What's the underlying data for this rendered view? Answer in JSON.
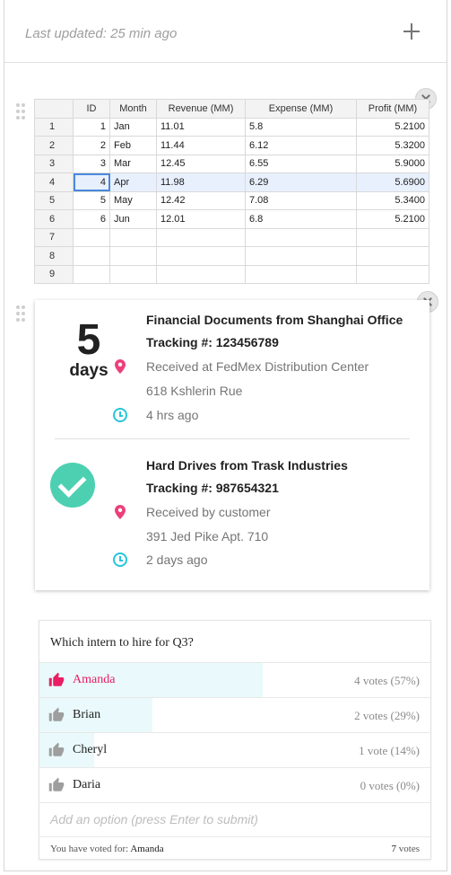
{
  "header": {
    "last_updated": "Last updated: 25 min ago",
    "add_icon": "plus-icon"
  },
  "spreadsheet": {
    "columns": [
      "ID",
      "Month",
      "Revenue (MM)",
      "Expense (MM)",
      "Profit (MM)"
    ],
    "row_headers": [
      "1",
      "2",
      "3",
      "4",
      "5",
      "6",
      "7",
      "8",
      "9"
    ],
    "rows": [
      [
        "1",
        "Jan",
        "11.01",
        "5.8",
        "5.2100"
      ],
      [
        "2",
        "Feb",
        "11.44",
        "6.12",
        "5.3200"
      ],
      [
        "3",
        "Mar",
        "12.45",
        "6.55",
        "5.9000"
      ],
      [
        "4",
        "Apr",
        "11.98",
        "6.29",
        "5.6900"
      ],
      [
        "5",
        "May",
        "12.42",
        "7.08",
        "5.3400"
      ],
      [
        "6",
        "Jun",
        "12.01",
        "6.8",
        "5.2100"
      ]
    ],
    "selected_row": 4
  },
  "tracking": {
    "countdown_value": "5",
    "countdown_unit": "days",
    "shipments": [
      {
        "title": "Financial Documents from Shanghai Office",
        "tracking": "Tracking #: 123456789",
        "status": "Received at FedMex Distribution Center",
        "address": "618 Kshlerin Rue",
        "time": "4 hrs ago"
      },
      {
        "title": "Hard Drives from Trask Industries",
        "tracking": "Tracking #: 987654321",
        "status": "Received by customer",
        "address": "391 Jed Pike Apt. 710",
        "time": "2 days ago"
      }
    ],
    "colors": {
      "pin": "#ec407a",
      "clock": "#26c6da",
      "check": "#4dd0b1"
    }
  },
  "poll": {
    "question": "Which intern to hire for Q3?",
    "options": [
      {
        "name": "Amanda",
        "votes": "4 votes (57%)",
        "fraction": 0.57,
        "voted": true
      },
      {
        "name": "Brian",
        "votes": "2 votes (29%)",
        "fraction": 0.29,
        "voted": false
      },
      {
        "name": "Cheryl",
        "votes": "1 vote (14%)",
        "fraction": 0.14,
        "voted": false
      },
      {
        "name": "Daria",
        "votes": "0 votes (0%)",
        "fraction": 0,
        "voted": false
      }
    ],
    "add_placeholder": "Add an option (press Enter to submit)",
    "voted_for_label": "You have voted for:",
    "voted_for": "Amanda",
    "total_votes": "7",
    "total_votes_label": "votes",
    "colors": {
      "voted": "#e91e63",
      "thumb": "#9e9e9e",
      "fill": "#eaf9fb"
    }
  }
}
